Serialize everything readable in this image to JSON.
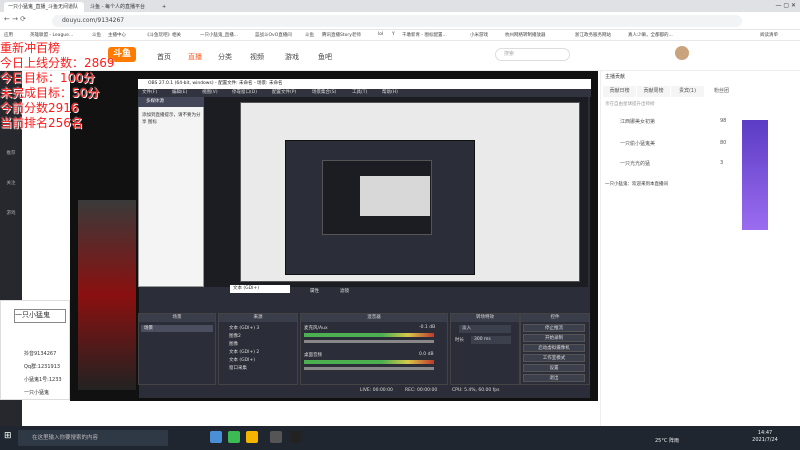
{
  "browser": {
    "tabs": [
      {
        "label": "一只小猛鬼_直播_斗鱼无间道队"
      },
      {
        "label": "斗鱼 - 每个人的直播平台"
      }
    ],
    "url": "douyu.com/9134267",
    "bookmarks": [
      "应用",
      "英雄联盟 - League...",
      "斗鱼",
      "主播中心",
      "《斗鱼玩吧》相关",
      "一只小猛鬼_直播...",
      "蓝战斗OvO直播间",
      "斗鱼",
      "腾讯直播Story老师",
      "lol",
      "Y",
      "千墩新青 - 图标配置...",
      "小米游戏",
      "杭州网络转制播放器",
      "浙江政务服务网站",
      "真人少嘛，全都都的...",
      "阅读清单"
    ]
  },
  "site": {
    "logo": "斗鱼",
    "nav": [
      "首页",
      "直播",
      "分类",
      "视频",
      "游戏",
      "鱼吧"
    ],
    "search_placeholder": "搜索"
  },
  "sidebar": [
    "推荐",
    "关注",
    "游戏",
    "电竞",
    "娱乐",
    "鱼吧"
  ],
  "overlay": {
    "line1": "重新冲百榜",
    "line2": "今日上线分数：2869",
    "line3": "今日目标：100分",
    "line4": "未完成目标：50分",
    "line5": "今前分数2916",
    "line6": "当前排名256名"
  },
  "obs": {
    "title": "OBS 27.0.1 (64-bit, windows) - 配置文件: 未命名 - 场景: 未命名",
    "menu": [
      "文件(F)",
      "编辑(E)",
      "视图(V)",
      "停靠窗口(D)",
      "配置文件(P)",
      "场景集合(S)",
      "工具(T)",
      "帮助(H)"
    ],
    "popup_title": "多媒体源",
    "popup_text": "添加到直播提示，请不要为分享 图标",
    "docks": {
      "scenes": "场景",
      "sources": "来源",
      "mixer": "混音器",
      "transitions": "转场特效",
      "controls": "控件"
    },
    "scene_item": "场景",
    "source_items": [
      "文本 (GDI+) 3",
      "图像2",
      "图像",
      "文本 (GDI+) 2",
      "文本 (GDI+)",
      "窗口采集"
    ],
    "mixer_tracks": [
      {
        "name": "桌面音频",
        "db": "0.0 dB"
      },
      {
        "name": "麦克风/Aux",
        "db": "-0.1 dB"
      }
    ],
    "transition": {
      "type": "淡入",
      "duration_label": "时长",
      "duration": "300 ms"
    },
    "controls": [
      "停止推流",
      "开始录制",
      "启动虚拟摄像机",
      "工作室模式",
      "设置",
      "退出"
    ],
    "status": {
      "live": "LIVE: 00:00:00",
      "rec": "REC: 00:00:00",
      "cpu": "CPU: 5.4%, 60.00 fps"
    },
    "preview_bar": [
      "属性",
      "滤镜"
    ],
    "toolbar": [
      "文本 (GDI+)"
    ]
  },
  "chat": {
    "tabs": [
      "贡献日榜",
      "贡献周榜",
      "贵宾(1)",
      "粉丝团"
    ],
    "header": "主播贡献",
    "notice": "亲在自由星球提升出师榜",
    "ranks": [
      {
        "name": "江西娜美女初第",
        "score": "98"
      },
      {
        "name": "一只偷小猛鬼美",
        "score": "80"
      },
      {
        "name": "一只光光的猛",
        "score": "3"
      }
    ],
    "welcome": "一只小猛鬼：欢迎来到本直播间"
  },
  "float_panel": {
    "title": "一只小猛鬼",
    "lines": [
      "抖音9134267",
      "Qq群:1231913",
      "小猛鬼1号:1233",
      "一只小猛鬼"
    ]
  },
  "taskbar": {
    "search_placeholder": "在这里输入你要搜索的内容",
    "weather": "25°C 阵雨",
    "time": "14:47",
    "date": "2021/7/24"
  }
}
